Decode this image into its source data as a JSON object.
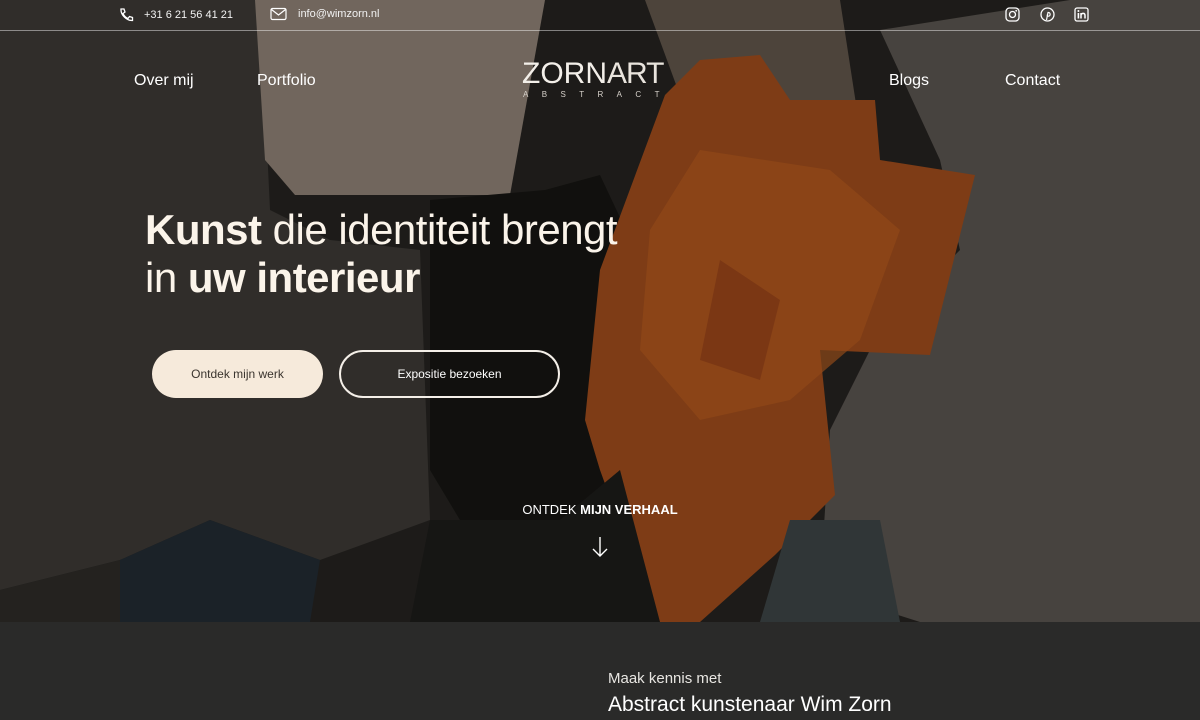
{
  "topbar": {
    "phone": "+31 6 21 56 41 21",
    "email": "info@wimzorn.nl",
    "social_icons": [
      "instagram-icon",
      "pinterest-icon",
      "linkedin-icon"
    ]
  },
  "nav": {
    "left": [
      "Over mij",
      "Portfolio"
    ],
    "right": [
      "Blogs",
      "Contact"
    ]
  },
  "logo": {
    "bold": "ZORN",
    "light": "ART",
    "sub": "ABSTRACT"
  },
  "hero": {
    "line1_bold": "Kunst",
    "line1_rest": "die identiteit brengt",
    "line2_prefix": "in",
    "line2_bold": "uw interieur",
    "primary_button": "Ontdek mijn werk",
    "secondary_button": "Expositie bezoeken",
    "discover_light": "ONTDEK",
    "discover_bold": "MIJN VERHAAL"
  },
  "intro": {
    "kicker": "Maak kennis met",
    "title": "Abstract kunstenaar Wim Zorn"
  },
  "colors": {
    "primary_button_bg": "#f6eadb",
    "footer_bg": "#2a2a29",
    "accent_orange": "#a9541c"
  }
}
